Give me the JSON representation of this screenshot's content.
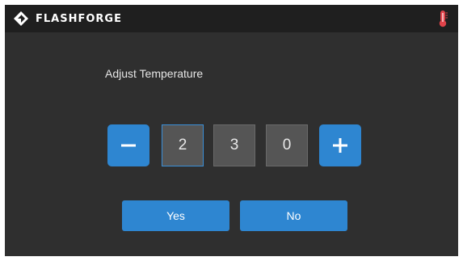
{
  "header": {
    "brand": "FLASHFORGE",
    "logo_icon": "flashforge-logo-icon",
    "status_icon": "thermometer-icon",
    "status_icon_color": "#e0434a"
  },
  "dialog": {
    "title": "Adjust Temperature",
    "minus_label": "−",
    "plus_label": "+",
    "digits": [
      "2",
      "3",
      "0"
    ],
    "active_digit_index": 0,
    "yes_label": "Yes",
    "no_label": "No"
  },
  "colors": {
    "accent": "#2e86d1",
    "background": "#2f2f2f",
    "header": "#1f1f1f",
    "digit_box": "#555555"
  }
}
